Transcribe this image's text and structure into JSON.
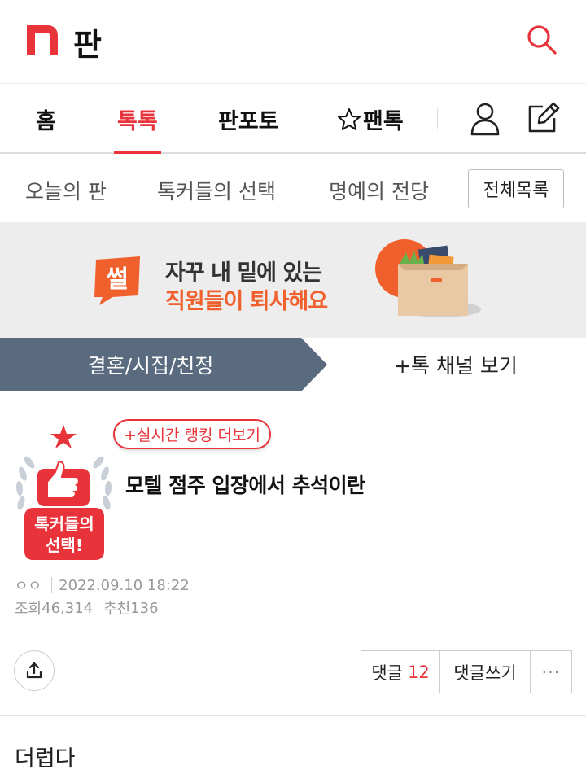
{
  "header": {
    "logo_text": "판",
    "logo_icon": "n-logo-icon",
    "search_icon": "search-icon"
  },
  "nav": {
    "items": [
      {
        "label": "홈",
        "active": false
      },
      {
        "label": "톡톡",
        "active": true
      },
      {
        "label": "판포토",
        "active": false
      },
      {
        "label": "팬톡",
        "active": false,
        "icon": "star-outline-icon"
      }
    ],
    "user_icon": "user-icon",
    "write_icon": "edit-icon"
  },
  "subnav": {
    "items": [
      "오늘의 판",
      "톡커들의 선택",
      "명예의 전당"
    ],
    "all_button": "전체목록"
  },
  "banner": {
    "badge": "썰",
    "line1": "자꾸 내 밑에 있는",
    "line2": "직원들이 퇴사해요"
  },
  "channel": {
    "name": "결혼/시집/친정",
    "more": "+톡 채널 보기"
  },
  "post": {
    "badge_text_1": "톡커들의",
    "badge_text_2": "선택!",
    "rank_link": "+실시간 랭킹 더보기",
    "title": "모텔 점주 입장에서 추석이란",
    "author": "ㅇㅇ",
    "date": "2022.09.10 18:22",
    "views_label": "조회",
    "views": "46,314",
    "recommend_label": "추천",
    "recommend": "136",
    "comment_label": "댓글",
    "comment_count": "12",
    "write_comment": "댓글쓰기",
    "more_label": "···",
    "body": "더럽다"
  },
  "colors": {
    "accent": "#e8333b",
    "channel_bg": "#5a6b80",
    "banner_orange": "#f0602d"
  }
}
